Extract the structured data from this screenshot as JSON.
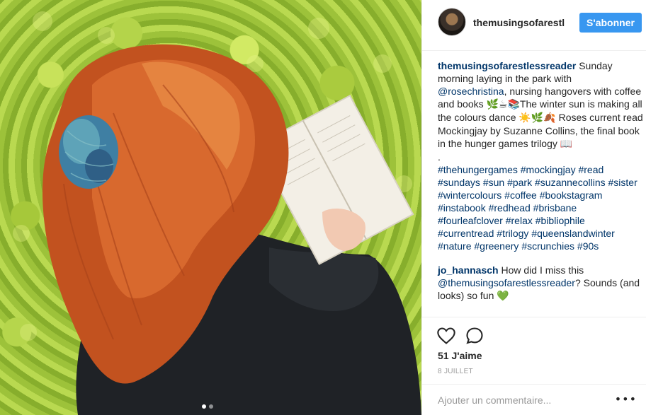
{
  "post": {
    "username": "themusingsofarestl",
    "follow_label": "S'abonner",
    "caption": {
      "username": "themusingsofarestlessreader",
      "text_1": " Sunday morning laying in the park with ",
      "mention": "@rosechristina",
      "text_2": ", nursing hangovers with coffee and books ",
      "emoji_1": "🌿☕📚",
      "text_3": "The winter sun is making all the colours dance ",
      "emoji_2": "☀️🌿🍂",
      "text_4": " Roses current read Mockingjay by Suzanne Collins, the final book in the hunger games trilogy ",
      "emoji_3": "📖",
      "dot": "."
    },
    "hashtags": [
      "#thehungergames",
      "#mockingjay",
      "#read",
      "#sundays",
      "#sun",
      "#park",
      "#suzannecollins",
      "#sister",
      "#wintercolours",
      "#coffee",
      "#bookstagram",
      "#instabook",
      "#redhead",
      "#brisbane",
      "#fourleafclover",
      "#relax",
      "#bibliophile",
      "#currentread",
      "#trilogy",
      "#queenslandwinter",
      "#nature",
      "#greenery",
      "#scrunchies",
      "#90s"
    ],
    "comment": {
      "username": "jo_hannasch",
      "text_1": " How did I miss this ",
      "mention": "@themusingsofarestlessreader",
      "text_2": "? Sounds (and looks) so fun ",
      "emoji": "💚"
    },
    "likes": "51 J'aime",
    "date": "8 JUILLET",
    "comment_placeholder": "Ajouter un commentaire...",
    "more_label": "•••",
    "icons": {
      "like": "heart-icon",
      "comment": "comment-icon",
      "more": "more-icon"
    }
  }
}
